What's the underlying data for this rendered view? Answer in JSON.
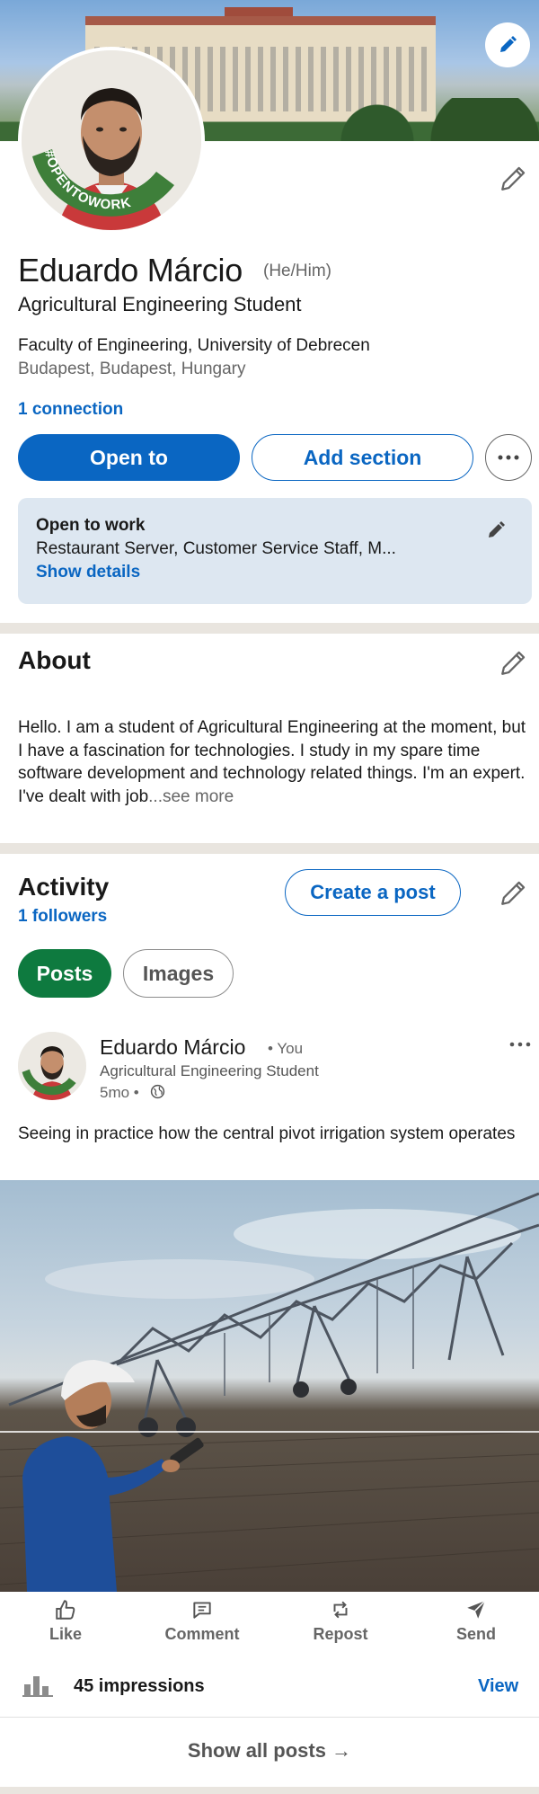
{
  "profile": {
    "name": "Eduardo Márcio",
    "pronouns": "(He/Him)",
    "headline": "Agricultural Engineering Student",
    "education": "Faculty of Engineering, University of Debrecen",
    "location": "Budapest, Budapest, Hungary",
    "connections": "1 connection",
    "open_to_work_badge": "#OPENTOWORK"
  },
  "actions": {
    "open_to": "Open to",
    "add_section": "Add section",
    "more": "more-options-icon"
  },
  "open_to_work": {
    "title": "Open to work",
    "description": "Restaurant Server, Customer Service Staff, M...",
    "link": "Show details"
  },
  "about": {
    "title": "About",
    "text": "Hello. I am a student of Agricultural Engineering at the moment, but I have a fascination for technologies. I study in my spare time software development and technology related things. I'm an expert. I've dealt with job",
    "see_more": "...see more"
  },
  "activity": {
    "title": "Activity",
    "followers": "1 followers",
    "create_post": "Create a post",
    "tabs": [
      {
        "label": "Posts",
        "active": true
      },
      {
        "label": "Images",
        "active": false
      }
    ]
  },
  "post": {
    "author": "Eduardo Márcio",
    "you": "• You",
    "headline": "Agricultural Engineering Student",
    "time": "5mo •",
    "text": "Seeing in practice how the central pivot irrigation system operates",
    "actions": [
      {
        "label": "Like",
        "icon": "like-icon"
      },
      {
        "label": "Comment",
        "icon": "comment-icon"
      },
      {
        "label": "Repost",
        "icon": "repost-icon"
      },
      {
        "label": "Send",
        "icon": "send-icon"
      }
    ],
    "impressions": "45 impressions",
    "view": "View"
  },
  "footer": {
    "show_all": "Show all posts →"
  },
  "colors": {
    "brand_blue": "#0a66c2",
    "open_to_work_green": "#0e7a3f",
    "divider": "#e9e5df"
  }
}
